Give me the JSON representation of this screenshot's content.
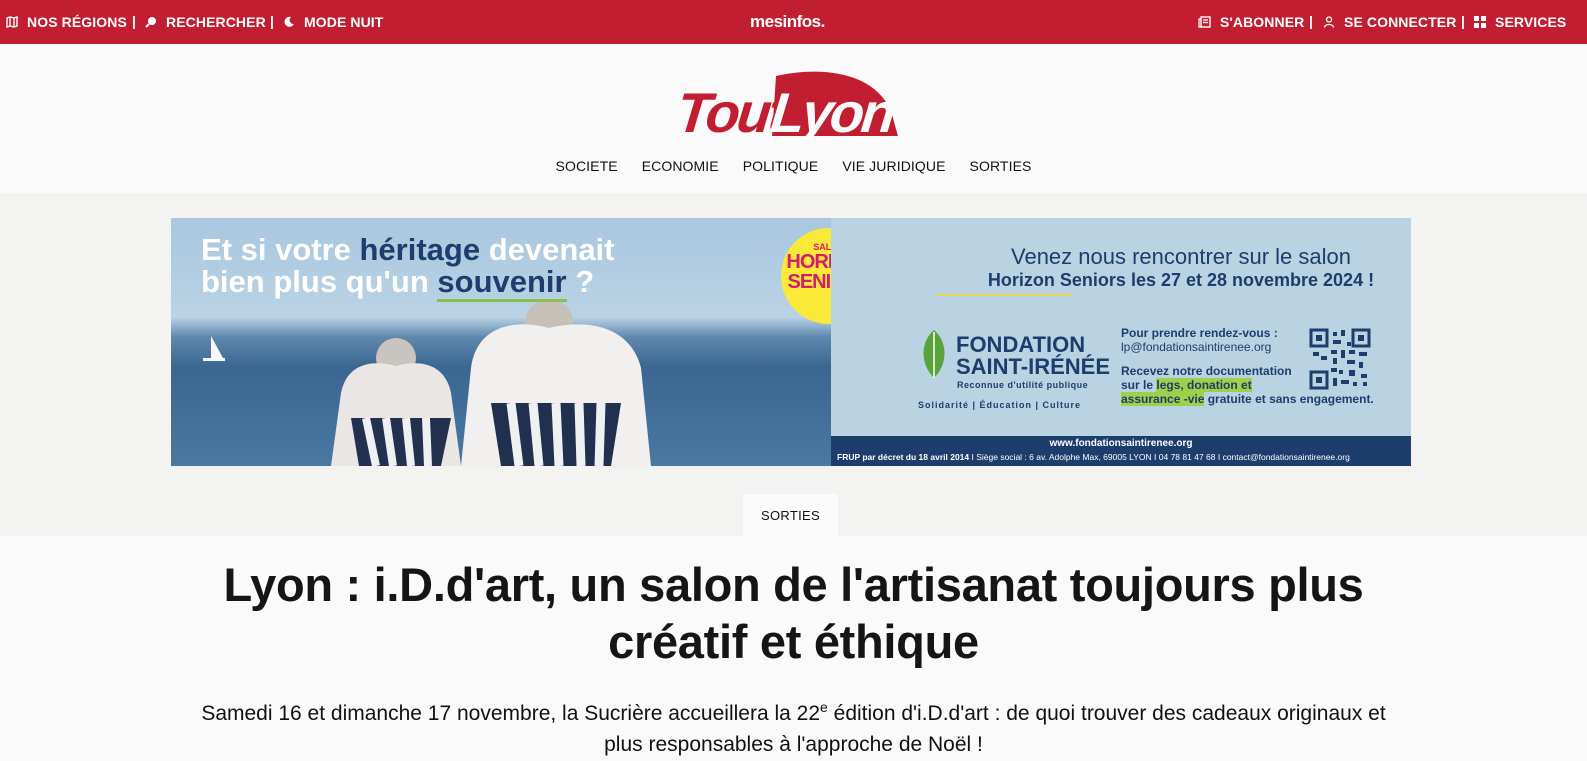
{
  "topbar": {
    "regions": "NOS RÉGIONS",
    "search": "RECHERCHER",
    "night": "MODE NUIT",
    "brand": "mesinfos.",
    "subscribe": "S'ABONNER",
    "login": "SE CONNECTER",
    "services": "SERVICES",
    "sep": "|"
  },
  "logo": {
    "text": "ToutLyon",
    "color": "#c21e31"
  },
  "nav": [
    "SOCIETE",
    "ECONOMIE",
    "POLITIQUE",
    "VIE JURIDIQUE",
    "SORTIES"
  ],
  "ad": {
    "headline_1a": "Et si votre ",
    "headline_1b": "héritage",
    "headline_1c": " devenait",
    "headline_2a": "bien plus qu'un ",
    "headline_2b": "souvenir",
    "headline_2c": " ?",
    "seal_top": "SALON",
    "seal_main_1": "HORIZON",
    "seal_main_2": "SENIORS",
    "venez": "Venez nous rencontrer sur le salon",
    "horizon": "Horizon Seniors les 27 et 28 novembre 2024 !",
    "fondation_1": "FONDATION",
    "fondation_2": "SAINT-IRÉNÉE",
    "fondation_sub": "Reconnue d'utilité publique",
    "fondation_values": "Solidarité  |  Éducation  |  Culture",
    "rdv_label": "Pour prendre rendez-vous :",
    "rdv_email": "lp@fondationsaintirenee.org",
    "doc_1": "Recevez notre documentation",
    "doc_2a": "sur le ",
    "doc_2b": "legs, donation et",
    "doc_3a": "assurance -vie",
    "doc_3b": " gratuite et sans engagement.",
    "url": "www.fondationsaintirenee.org",
    "legal_b": "FRUP par décret du 18 avril 2014",
    "legal": " I Siège social : 6 av. Adolphe Max, 69005 LYON I 04 78 81 47 68 I contact@fondationsaintirenee.org"
  },
  "category": "SORTIES",
  "article": {
    "title": "Lyon : i.D.d'art, un salon de l'artisanat toujours plus créatif et éthique",
    "lead_a": "Samedi 16 et dimanche 17 novembre, la Sucrière accueillera la 22",
    "lead_sup": "e",
    "lead_b": " édition d'i.D.d'art : de quoi trouver des cadeaux originaux et plus responsables à l'approche de Noël !"
  },
  "colors": {
    "brand_red": "#c21e31",
    "navy": "#1d3d6c",
    "highlight_green": "#9fd04a",
    "seal_yellow": "#fbe93a"
  }
}
